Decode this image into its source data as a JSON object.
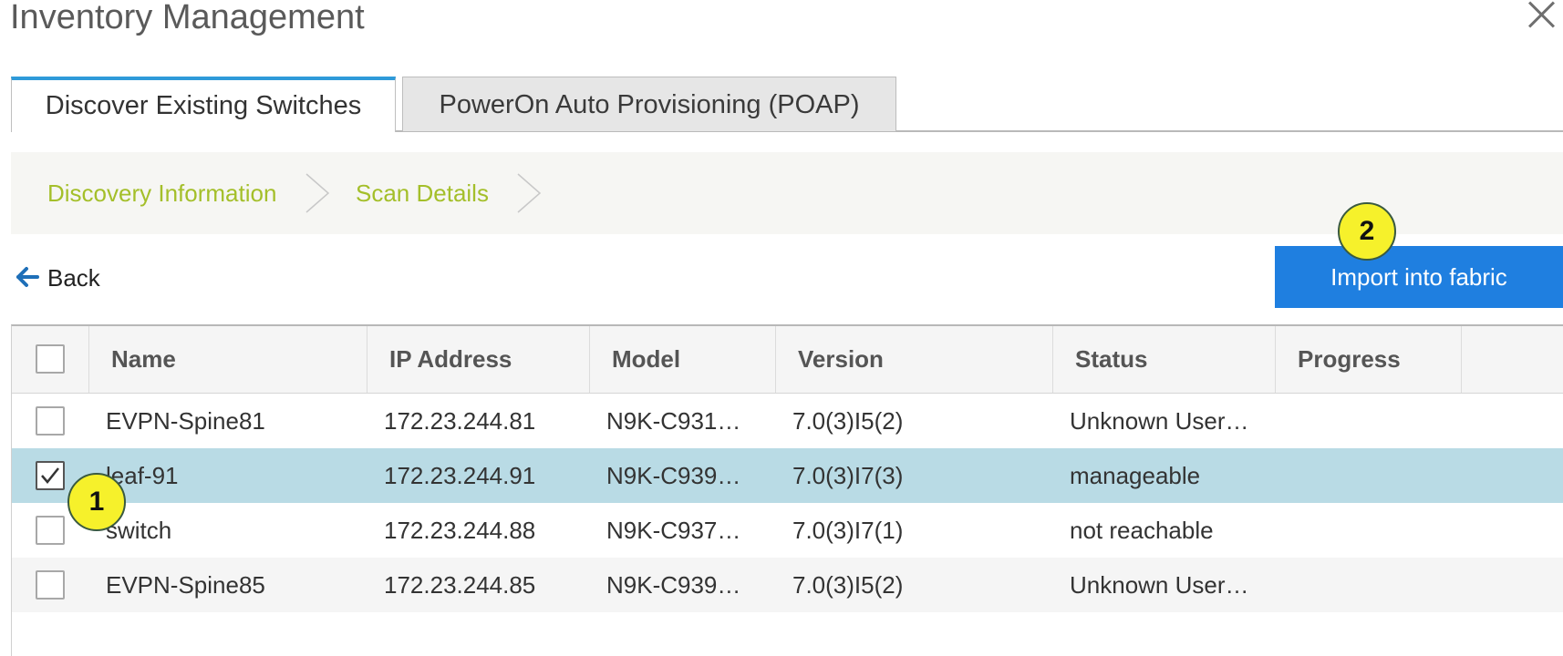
{
  "dialog": {
    "title": "Inventory Management"
  },
  "tabs": [
    {
      "label": "Discover Existing Switches",
      "active": true
    },
    {
      "label": "PowerOn Auto Provisioning (POAP)",
      "active": false
    }
  ],
  "steps": [
    "Discovery Information",
    "Scan Details"
  ],
  "toolbar": {
    "back_label": "Back",
    "import_label": "Import into fabric"
  },
  "callouts": [
    "1",
    "2"
  ],
  "table": {
    "columns": [
      "Name",
      "IP Address",
      "Model",
      "Version",
      "Status",
      "Progress"
    ],
    "rows": [
      {
        "name": "EVPN-Spine81",
        "ip": "172.23.244.81",
        "model": "N9K-C931…",
        "version": "7.0(3)I5(2)",
        "status": "Unknown User…",
        "progress": "",
        "checked": false
      },
      {
        "name": "leaf-91",
        "ip": "172.23.244.91",
        "model": "N9K-C939…",
        "version": "7.0(3)I7(3)",
        "status": "manageable",
        "progress": "",
        "checked": true
      },
      {
        "name": "switch",
        "ip": "172.23.244.88",
        "model": "N9K-C937…",
        "version": "7.0(3)I7(1)",
        "status": "not reachable",
        "progress": "",
        "checked": false
      },
      {
        "name": "EVPN-Spine85",
        "ip": "172.23.244.85",
        "model": "N9K-C939…",
        "version": "7.0(3)I5(2)",
        "status": "Unknown User…",
        "progress": "",
        "checked": false
      }
    ]
  },
  "colors": {
    "accent": "#1f7fe0",
    "tab_active_border": "#2e9ad9",
    "step_text": "#a4bf2a",
    "selected_row": "#b9dbe5",
    "callout_fill": "#f6f12b"
  }
}
